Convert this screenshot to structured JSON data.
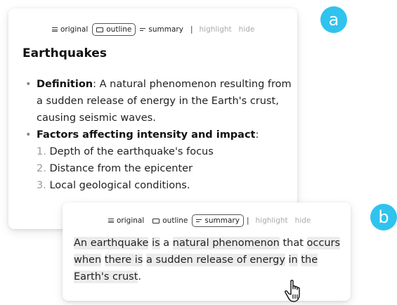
{
  "card_a": {
    "toolbar": {
      "original": "original",
      "outline": "outline",
      "summary": "summary",
      "separator": "|",
      "highlight": "highlight",
      "hide": "hide",
      "active": "outline"
    },
    "heading": "Earthquakes",
    "bullets": [
      {
        "term": "Definition",
        "sep": ":",
        "text": " A natural phenomenon resulting from a sudden release of energy in the Earth's crust, causing seismic waves."
      },
      {
        "term": "Factors affecting intensity and impact",
        "sep": ":",
        "text": ""
      }
    ],
    "factors": [
      {
        "num": "1.",
        "text": "Depth of the earthquake's focus"
      },
      {
        "num": "2.",
        "text": "Distance from the epicenter"
      },
      {
        "num": "3.",
        "text": "Local geological conditions."
      }
    ]
  },
  "card_b": {
    "toolbar": {
      "original": "original",
      "outline": "outline",
      "summary": "summary",
      "separator": "|",
      "highlight": "highlight",
      "hide": "hide",
      "active": "summary"
    },
    "summary_tokens": [
      {
        "t": "An earthquake",
        "hl": true
      },
      {
        "t": " ",
        "hl": false
      },
      {
        "t": "is",
        "hl": true
      },
      {
        "t": " a ",
        "hl": false
      },
      {
        "t": "natural phenomenon",
        "hl": true
      },
      {
        "t": " that ",
        "hl": false
      },
      {
        "t": "occurs",
        "hl": true
      },
      {
        "t": " ",
        "hl": false
      },
      {
        "t": "when",
        "hl": true
      },
      {
        "t": " ",
        "hl": false
      },
      {
        "t": "there is",
        "hl": true
      },
      {
        "t": " ",
        "hl": false
      },
      {
        "t": "a sudden release of energy",
        "hl": true
      },
      {
        "t": " ",
        "hl": false
      },
      {
        "t": "in",
        "hl": true
      },
      {
        "t": " ",
        "hl": false
      },
      {
        "t": "the Earth's crust",
        "hl": true
      },
      {
        "t": ".",
        "hl": false
      }
    ]
  },
  "badges": {
    "a": "a",
    "b": "b"
  },
  "colors": {
    "badge": "#2fc3ee",
    "highlight": "#ececec"
  },
  "cursor_icon": "hand-pointer-icon"
}
